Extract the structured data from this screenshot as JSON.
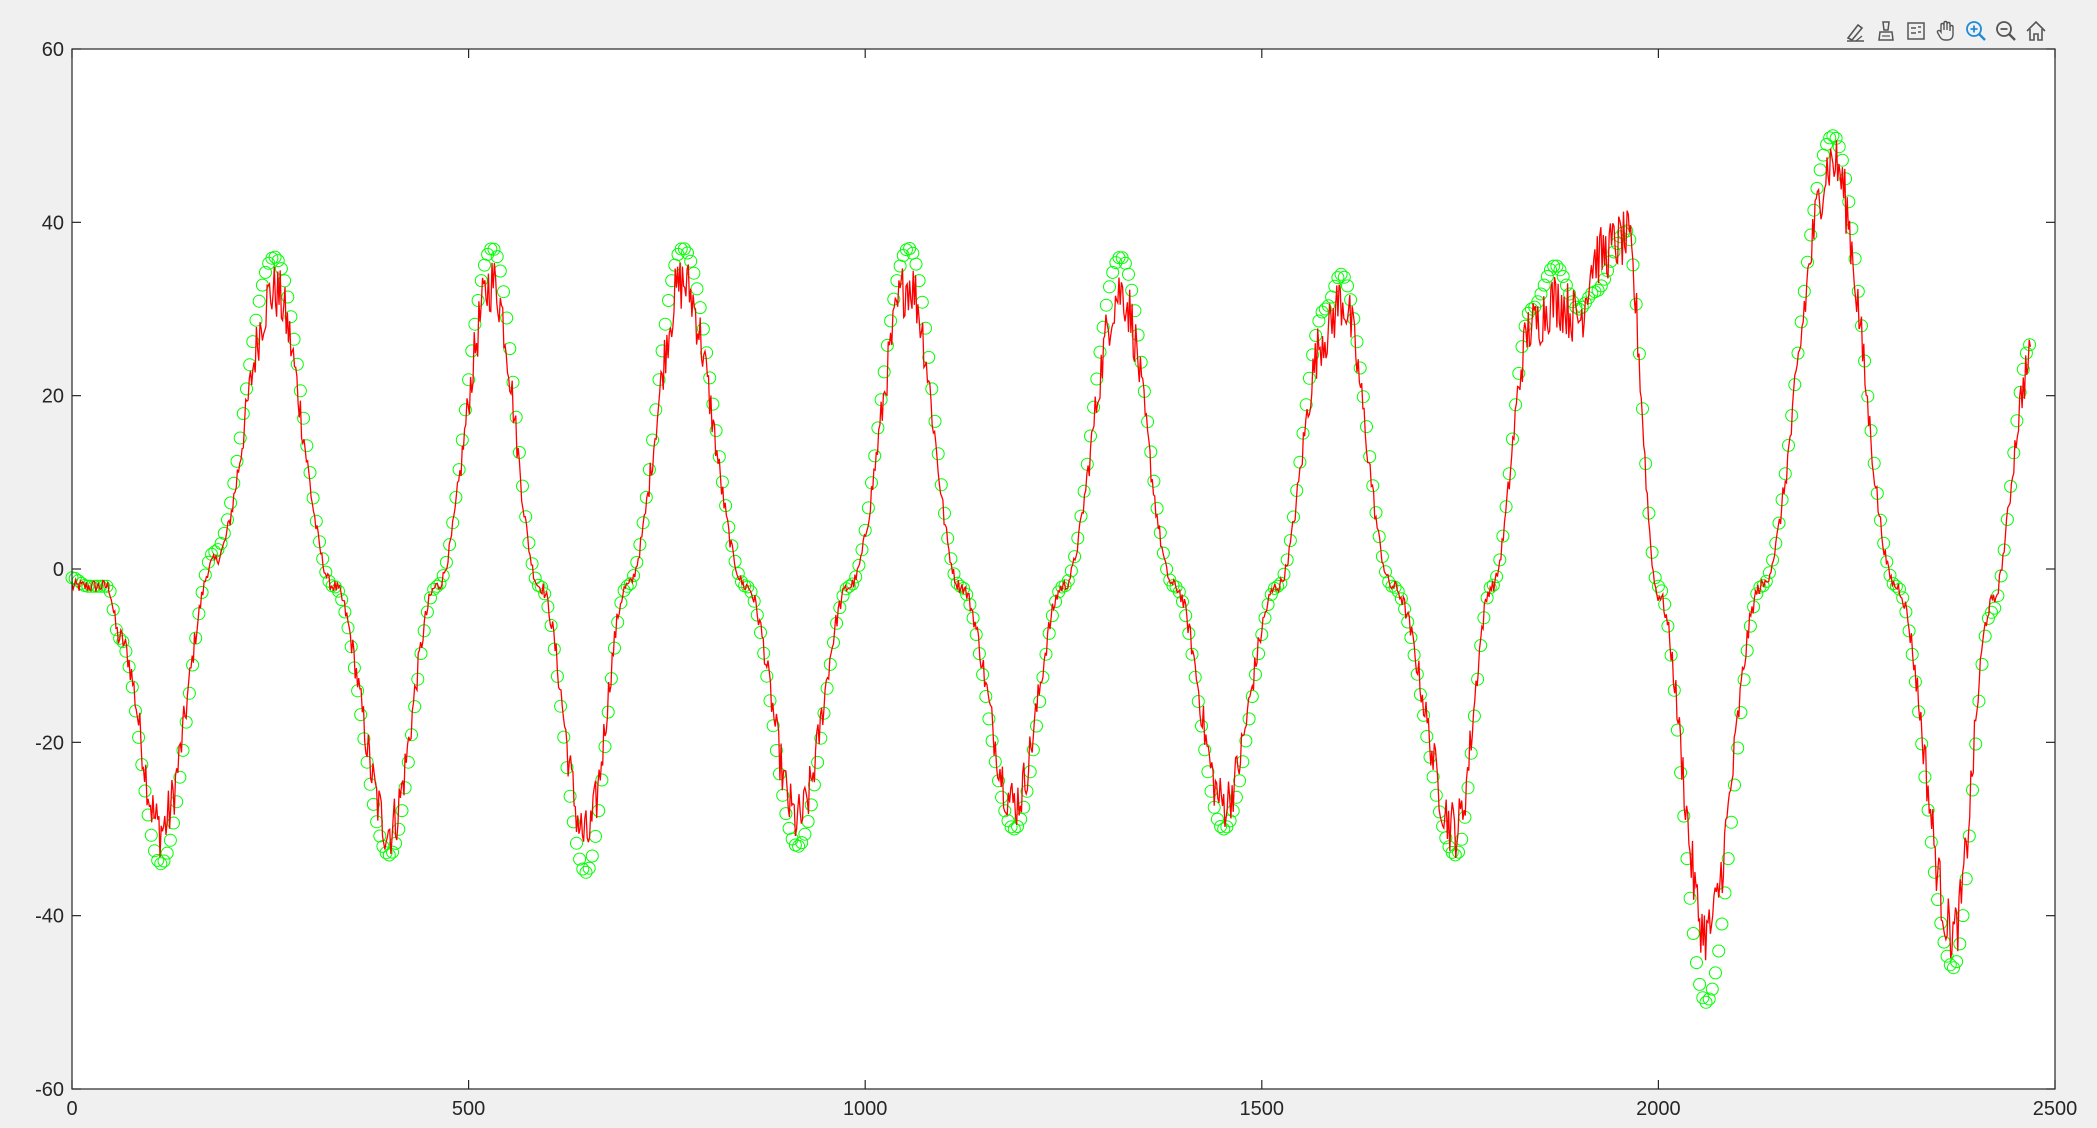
{
  "toolbar": {
    "icons": [
      "brush-pen-icon",
      "data-tips-icon",
      "legend-icon",
      "pan-hand-icon",
      "zoom-in-icon",
      "zoom-out-icon",
      "home-icon"
    ]
  },
  "colors": {
    "background": "#f0f0f0",
    "axes_bg": "#ffffff",
    "axis": "#262626",
    "noisy_line": "#ff0000",
    "marker": "#00ff00",
    "zoom_active": "#1e8bd6",
    "icon": "#555555"
  },
  "chart_data": {
    "type": "line",
    "title": "",
    "xlabel": "",
    "ylabel": "",
    "xlim": [
      0,
      2500
    ],
    "ylim": [
      -60,
      60
    ],
    "xticks": [
      0,
      500,
      1000,
      1500,
      2000,
      2500
    ],
    "yticks": [
      60,
      40,
      20,
      0,
      -20,
      -40,
      -60
    ],
    "grid": false,
    "box": true,
    "series": [
      {
        "style": "scatter-circles",
        "color": "#00ff00",
        "x": [
          0,
          20,
          45,
          60,
          112,
          180,
          255,
          330,
          400,
          460,
          530,
          590,
          648,
          700,
          770,
          850,
          915,
          980,
          1055,
          1120,
          1188,
          1250,
          1322,
          1390,
          1452,
          1520,
          1580,
          1600,
          1665,
          1745,
          1790,
          1840,
          1870,
          1900,
          1920,
          1960,
          2000,
          2060,
          2130,
          2220,
          2300,
          2372,
          2420,
          2470
        ],
        "y": [
          -1,
          -2,
          -2,
          -8,
          -34,
          2,
          36,
          -2,
          -33,
          -2,
          37,
          -2,
          -35,
          -2,
          37,
          -2,
          -32,
          -2,
          37,
          -2,
          -30,
          -2,
          36,
          -2,
          -30,
          -2,
          30,
          34,
          -2,
          -33,
          -2,
          30,
          35,
          30,
          32,
          39,
          -2,
          -50,
          -2,
          50,
          -2,
          -46,
          -5,
          26
        ]
      },
      {
        "style": "noisy-line",
        "color": "#ff0000",
        "x": [
          0,
          20,
          45,
          60,
          112,
          180,
          255,
          330,
          400,
          460,
          530,
          590,
          648,
          700,
          770,
          850,
          915,
          980,
          1055,
          1120,
          1188,
          1250,
          1322,
          1390,
          1452,
          1520,
          1580,
          1600,
          1665,
          1745,
          1790,
          1840,
          1870,
          1900,
          1920,
          1960,
          2000,
          2060,
          2130,
          2220,
          2300,
          2372,
          2420,
          2470
        ],
        "y": [
          -2,
          -2,
          -2,
          -8,
          -30,
          1,
          32,
          -2,
          -30,
          -2,
          33,
          -2,
          -31,
          -2,
          33,
          -2,
          -29,
          -2,
          33,
          -2,
          -27,
          -2,
          32,
          -2,
          -27,
          -2,
          27,
          31,
          -2,
          -30,
          -2,
          28,
          31,
          29,
          36,
          38,
          -3,
          -42,
          -2,
          47,
          -2,
          -42,
          -4,
          24
        ]
      }
    ]
  }
}
